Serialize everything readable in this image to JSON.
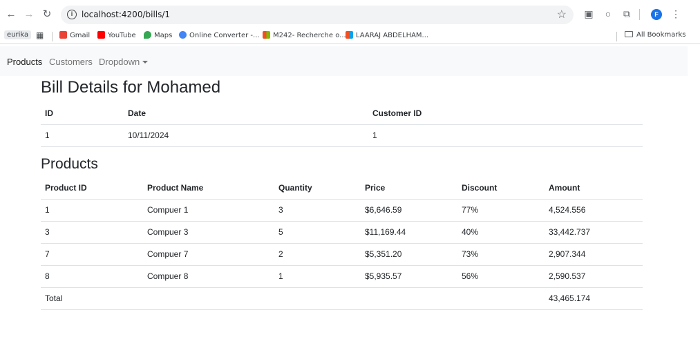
{
  "browser": {
    "url": "localhost:4200/bills/1",
    "profile_initial": "F",
    "bookmarks": [
      {
        "label": "eurika",
        "color": "#e8eaed"
      },
      {
        "label": "Gmail",
        "color": "#ea4335"
      },
      {
        "label": "YouTube",
        "color": "#ff0000"
      },
      {
        "label": "Maps",
        "color": "#34a853"
      },
      {
        "label": "Online Converter -...",
        "color": "#4285f4"
      },
      {
        "label": "M242- Recherche o...",
        "color": "#f25022"
      },
      {
        "label": "LAARAJ ABDELHAM...",
        "color": "#f25022"
      }
    ],
    "all_bookmarks_label": "All Bookmarks"
  },
  "navbar": {
    "items": [
      {
        "label": "Products",
        "active": true
      },
      {
        "label": "Customers",
        "active": false
      },
      {
        "label": "Dropdown",
        "active": false
      }
    ]
  },
  "bill": {
    "title": "Bill Details for Mohamed",
    "headers": [
      "ID",
      "Date",
      "Customer ID"
    ],
    "row": [
      "1",
      "10/11/2024",
      "1"
    ]
  },
  "products": {
    "title": "Products",
    "headers": [
      "Product ID",
      "Product Name",
      "Quantity",
      "Price",
      "Discount",
      "Amount"
    ],
    "rows": [
      [
        "1",
        "Compuer 1",
        "3",
        "$6,646.59",
        "77%",
        "4,524.556"
      ],
      [
        "3",
        "Compuer 3",
        "5",
        "$11,169.44",
        "40%",
        "33,442.737"
      ],
      [
        "7",
        "Compuer 7",
        "2",
        "$5,351.20",
        "73%",
        "2,907.344"
      ],
      [
        "8",
        "Compuer 8",
        "1",
        "$5,935.57",
        "56%",
        "2,590.537"
      ]
    ],
    "total_label": "Total",
    "total_amount": "43,465.174"
  }
}
